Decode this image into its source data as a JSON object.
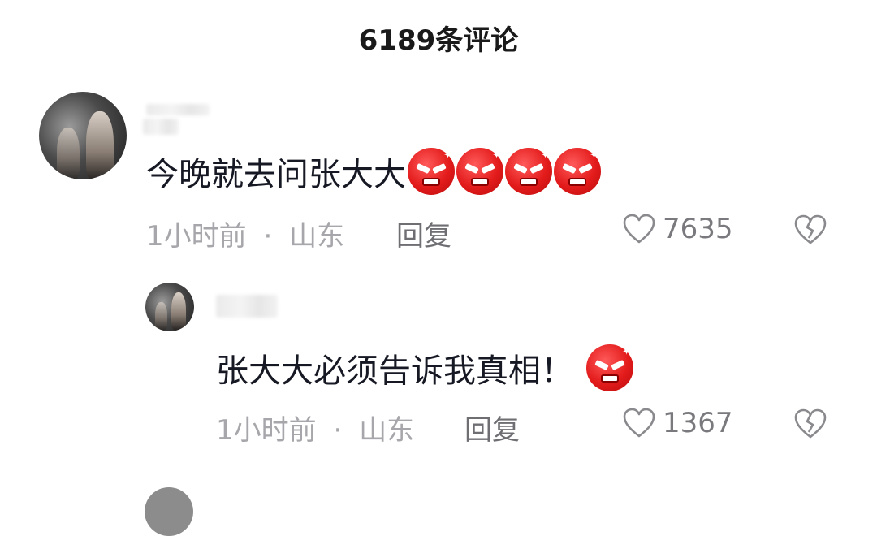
{
  "header": {
    "title": "6189条评论"
  },
  "comments": [
    {
      "text": "今晚就去问张大大",
      "emoji": "angry-face-icon",
      "emoji_count": 4,
      "time": "1小时前",
      "separator": "·",
      "location": "山东",
      "reply_label": "回复",
      "likes": "7635"
    },
    {
      "text": "张大大必须告诉我真相！",
      "emoji": "angry-face-icon",
      "emoji_count": 1,
      "time": "1小时前",
      "separator": "·",
      "location": "山东",
      "reply_label": "回复",
      "likes": "1367"
    }
  ],
  "colors": {
    "text": "#161823",
    "meta": "#a7a7ab",
    "emoji": "#e31b1b"
  }
}
